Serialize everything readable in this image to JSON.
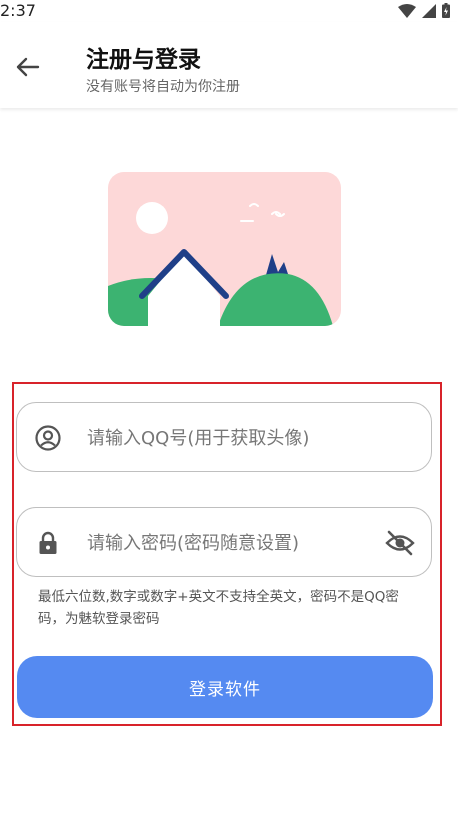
{
  "status_bar": {
    "time": "2:37"
  },
  "app_bar": {
    "title": "注册与登录",
    "subtitle": "没有账号将自动为你注册"
  },
  "form": {
    "qq_placeholder": "请输入QQ号(用于获取头像)",
    "password_placeholder": "请输入密码(密码随意设置)",
    "hint": "最低六位数,数字或数字+英文不支持全英文，密码不是QQ密码，为魅软登录密码",
    "login_label": "登录软件"
  },
  "colors": {
    "primary_button": "#558af1",
    "highlight_border": "#d8232a",
    "illustration_bg": "#fdd8d8",
    "hill": "#3cb371",
    "house_outline": "#1f3f88"
  },
  "icons": {
    "back": "arrow-left-icon",
    "account": "account-circle-icon",
    "lock": "lock-icon",
    "visibility": "eye-off-icon"
  }
}
